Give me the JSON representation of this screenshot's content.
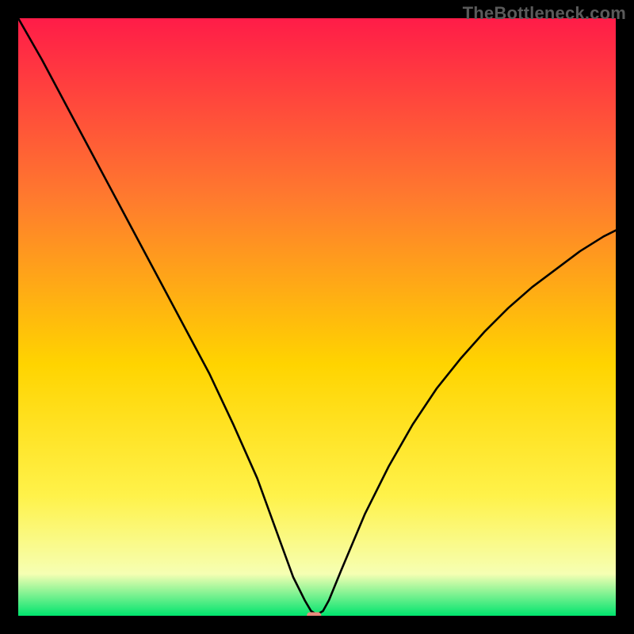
{
  "watermark": "TheBottleneck.com",
  "chart_data": {
    "type": "line",
    "title": "",
    "xlabel": "",
    "ylabel": "",
    "xlim": [
      0,
      100
    ],
    "ylim": [
      0,
      100
    ],
    "legend": false,
    "grid": false,
    "background_gradient": {
      "top": "#ff1c48",
      "upper_mid": "#ff7a2e",
      "mid": "#ffd400",
      "lower_mid": "#fff24a",
      "lower": "#f6ffb3",
      "bottom": "#00e46e"
    },
    "series": [
      {
        "name": "bottleneck-curve",
        "color": "#000000",
        "x": [
          0,
          4,
          8,
          12,
          16,
          20,
          24,
          28,
          32,
          36,
          40,
          44,
          46,
          48,
          49,
          50,
          51,
          52,
          54,
          58,
          62,
          66,
          70,
          74,
          78,
          82,
          86,
          90,
          94,
          98,
          100
        ],
        "y": [
          100,
          93,
          85.5,
          78,
          70.5,
          63,
          55.5,
          48,
          40.5,
          32,
          23,
          12,
          6.5,
          2.5,
          0.8,
          0.2,
          0.8,
          2.6,
          7.5,
          17,
          25,
          32,
          38,
          43,
          47.5,
          51.5,
          55,
          58,
          61,
          63.5,
          64.5
        ]
      }
    ],
    "ideal_marker": {
      "x": 49.5,
      "y": 0,
      "color": "#e98b7e",
      "width": 2.4,
      "height": 1.2
    }
  }
}
